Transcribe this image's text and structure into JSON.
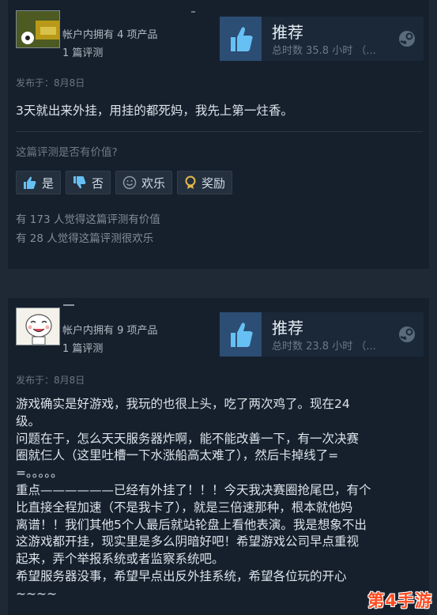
{
  "reviews": [
    {
      "owned_products": "帐户内拥有 4 项产品",
      "review_count": "1 篇评测",
      "recommend_label": "推荐",
      "hours": "总时数 35.8 小时 （...",
      "posted": "发布于：8月8日",
      "text": "3天就出来外挂，用挂的都死妈，我先上第一炷香。",
      "helpful_question": "这篇评测是否有价值?",
      "vote_buttons": [
        "是",
        "否",
        "欢乐",
        "奖励"
      ],
      "helpful_stat": "有 173 人觉得这篇评测有价值",
      "funny_stat": "有 28 人觉得这篇评测很欢乐"
    },
    {
      "owned_products": "帐户内拥有 9 项产品",
      "review_count": "1 篇评测",
      "recommend_label": "推荐",
      "hours": "总时数 23.8 小时 （...",
      "posted": "发布于：8月8日",
      "lines": [
        "游戏确实是好游戏，我玩的也很上头，吃了两次鸡了。现在24",
        "级。",
        "问题在于，怎么天天服务器炸啊，能不能改善一下，有一次决赛",
        "圈就仨人（这里吐槽一下水涨船高太难了），然后卡掉线了=",
        "=。。。。。",
        "重点——————已经有外挂了！！！今天我决赛圈抢尾巴，有个",
        "比直接全程加速（不是我卡了），就是三倍速那种，根本就他妈",
        "离谱！！我们其他5个人最后就站轮盘上看他表演。我是想象不出",
        "这游戏都开挂，现实里是多么阴暗好吧！希望游戏公司早点重视",
        "起来，弄个举报系统或者监察系统吧。",
        "希望服务器没事，希望早点出反外挂系统，希望各位玩的开心",
        "~~~~"
      ]
    }
  ],
  "watermark": "第4手游",
  "icons": {
    "thumbs_up": "thumbs-up-icon",
    "thumbs_down": "thumbs-down-icon",
    "smiley": "smiley-icon",
    "award": "award-icon",
    "steam": "steam-logo-icon"
  },
  "colors": {
    "background": "#1f2935",
    "card": "#16202d",
    "thumb_box": "#2c4d74",
    "thumb": "#66c0f4",
    "watermark": "#ff4b1f"
  }
}
